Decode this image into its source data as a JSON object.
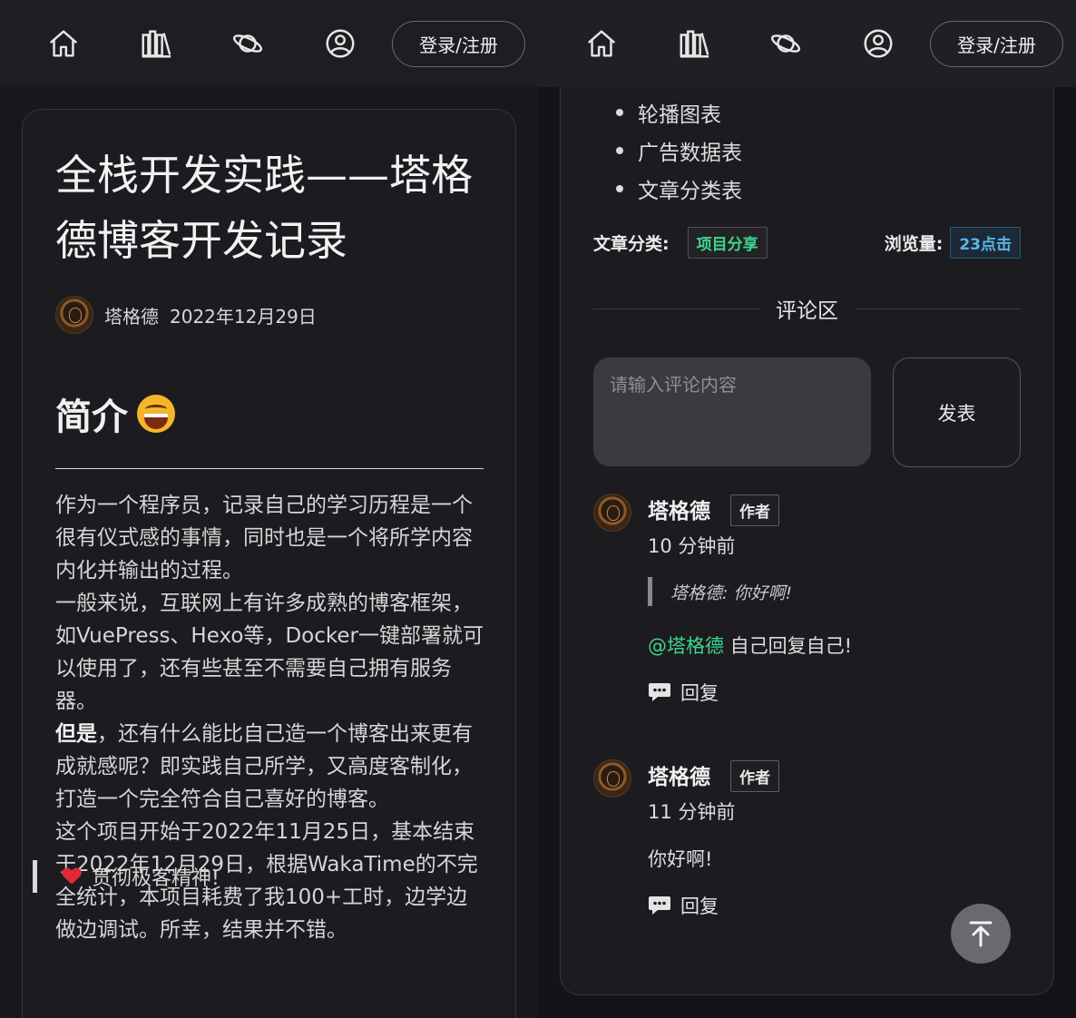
{
  "nav": {
    "login_label": "登录/注册",
    "icons": [
      "home-icon",
      "library-icon",
      "planet-icon",
      "user-icon"
    ]
  },
  "post": {
    "title": "全栈开发实践——塔格德博客开发记录",
    "author": "塔格德",
    "date": "2022年12月29日",
    "section_heading": "简介",
    "paragraphs": [
      "作为一个程序员，记录自己的学习历程是一个很有仪式感的事情，同时也是一个将所学内容内化并输出的过程。",
      "一般来说，互联网上有许多成熟的博客框架，如VuePress、Hexo等，Docker一键部署就可以使用了，还有些甚至不需要自己拥有服务器。",
      "还有什么能比自己造一个博客出来更有成就感呢？即实践自己所学，又高度客制化，打造一个完全符合自己喜好的博客。",
      "这个项目开始于2022年11月25日，基本结束于2022年12月29日，根据WakaTime的不完全统计，本项目耗费了我100+工时，边学边做边调试。所幸，结果并不错。"
    ],
    "bold_lead": "但是",
    "quote": "贯彻极客精神!"
  },
  "right": {
    "bullets": [
      "轮播图表",
      "广告数据表",
      "文章分类表"
    ],
    "category_label": "文章分类:",
    "category_value": "项目分享",
    "views_label": "浏览量:",
    "views_value": "23点击",
    "comments_heading": "评论区",
    "comment_placeholder": "请输入评论内容",
    "submit_label": "发表",
    "comments": [
      {
        "name": "塔格德",
        "badge": "作者",
        "time": "10 分钟前",
        "quote": "塔格德: 你好啊!",
        "mention": "@塔格德",
        "text": " 自己回复自己!",
        "reply_label": "回复"
      },
      {
        "name": "塔格德",
        "badge": "作者",
        "time": "11 分钟前",
        "text": "你好啊!",
        "reply_label": "回复"
      }
    ]
  },
  "colors": {
    "accent_green": "#3dd68c",
    "accent_blue": "#5ab4e8",
    "background": "#17171c"
  }
}
